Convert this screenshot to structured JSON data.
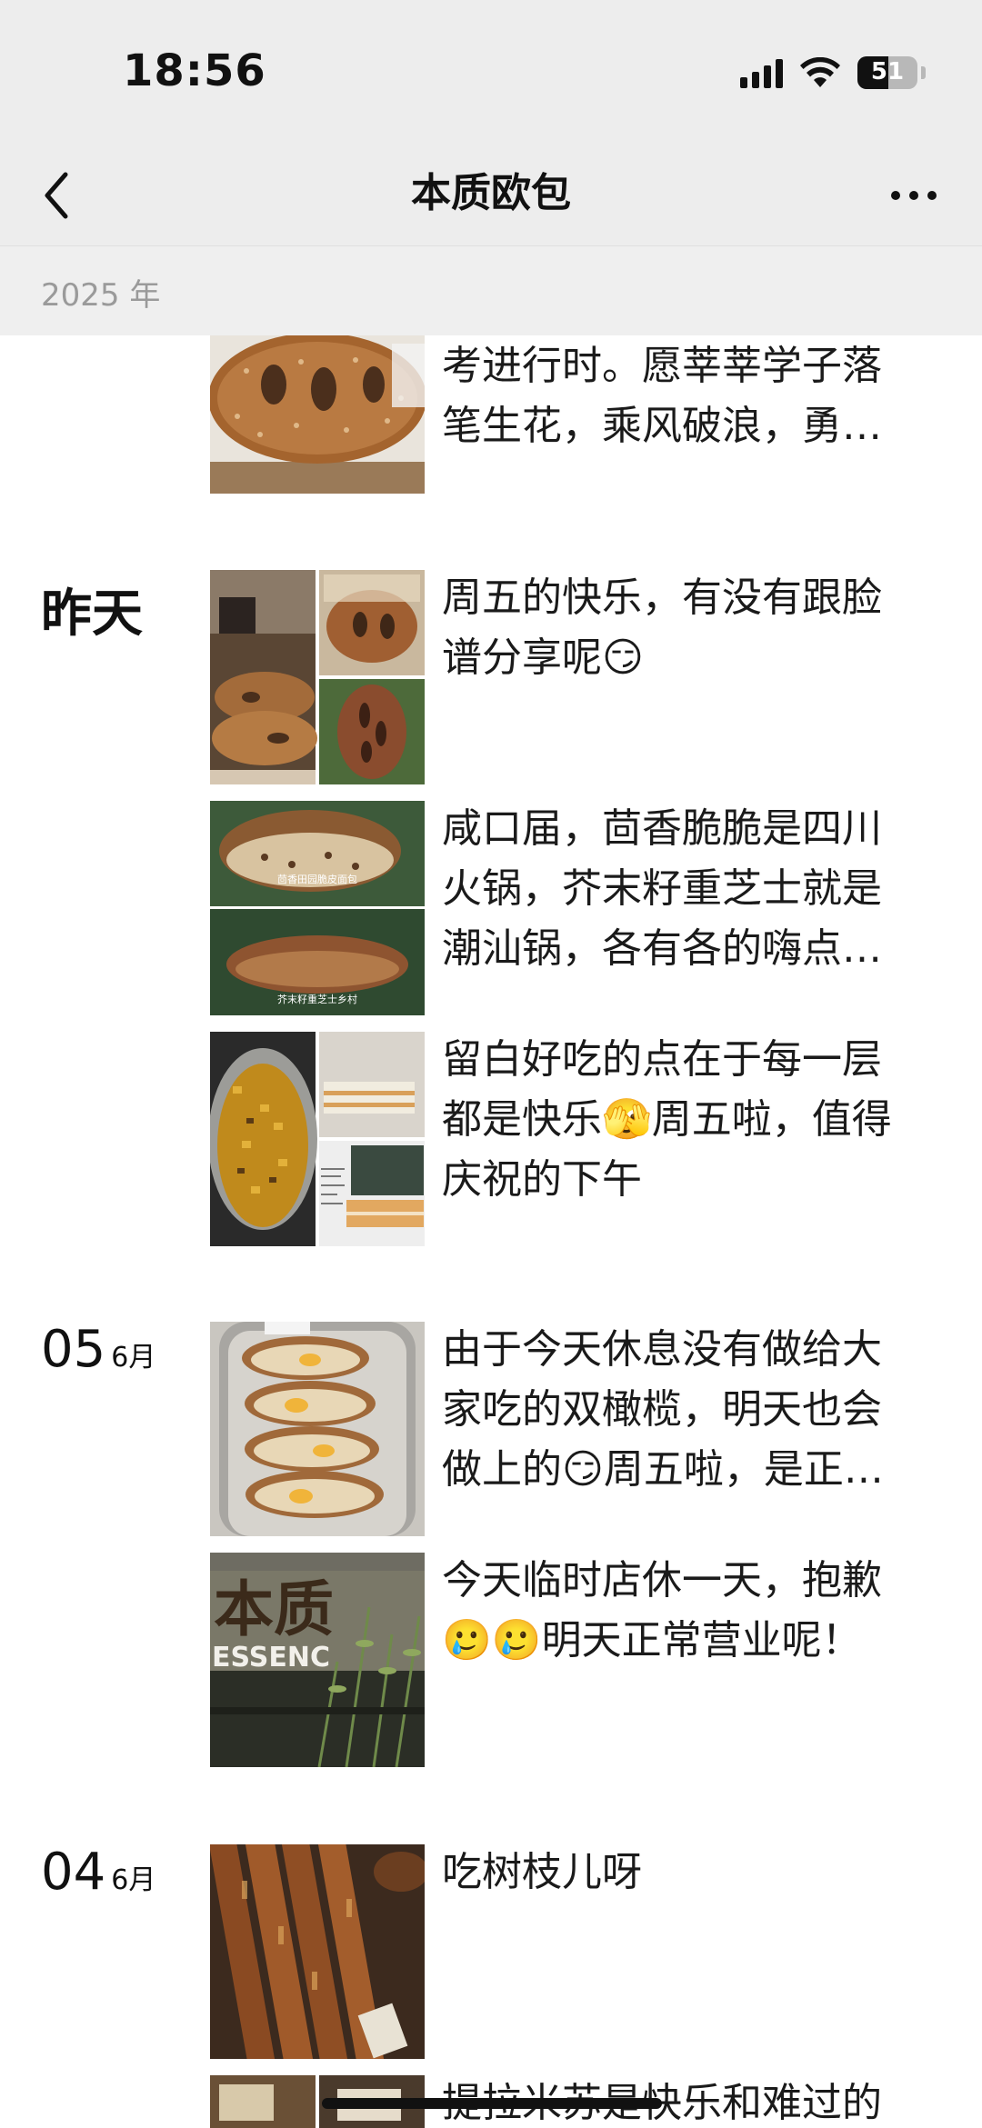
{
  "status_bar": {
    "time": "18:56",
    "battery": "51",
    "icons": [
      "signal-icon",
      "wifi-icon",
      "battery-icon"
    ]
  },
  "nav": {
    "title": "本质欧包",
    "back_icon": "chevron-left-icon",
    "more_icon": "more-dots-icon"
  },
  "year_header": "2025 年",
  "groups": [
    {
      "date_label": "",
      "posts": [
        {
          "text": "考进行时。愿莘莘学子落笔生花，乘风破浪，勇往直前",
          "image": "bread-ring-photo"
        }
      ]
    },
    {
      "date_label": "昨天",
      "posts": [
        {
          "text": "周五的快乐，有没有跟脸谱分享呢😏",
          "image": "fougasse-collage"
        },
        {
          "text": "咸口届，茴香脆脆是四川火锅，芥末籽重芝士就是潮汕锅，各有各的嗨点，都很好吃",
          "image": "loaf-duo-photo",
          "image_captions": [
            "茴香田园脆皮面包",
            "芥末籽重芝士乡村"
          ]
        },
        {
          "text": "留白好吃的点在于每一层都是快乐🫣周五啦，值得庆祝的下午",
          "image": "dessert-collage"
        }
      ]
    },
    {
      "date_day": "05",
      "date_month": "6月",
      "posts": [
        {
          "text": "由于今天休息没有做给大家吃的双橄榄，明天也会做上的😏周五啦，是正式的周末",
          "image": "sliced-bread-tray"
        },
        {
          "text": "今天临时店休一天，抱歉🥲🥲明天正常营业呢！",
          "image": "storefront-sign",
          "image_captions": [
            "本质",
            "ESSENC"
          ]
        }
      ]
    },
    {
      "date_day": "04",
      "date_month": "6月",
      "posts": [
        {
          "text": "吃树枝儿呀",
          "image": "baguette-sticks"
        },
        {
          "text": "提拉米苏是快乐和难过的",
          "image": "tiramisu-collage"
        }
      ]
    }
  ],
  "colors": {
    "header_bg": "#ededed",
    "year_text": "#9a9a9a",
    "text": "#1a1a1a"
  }
}
